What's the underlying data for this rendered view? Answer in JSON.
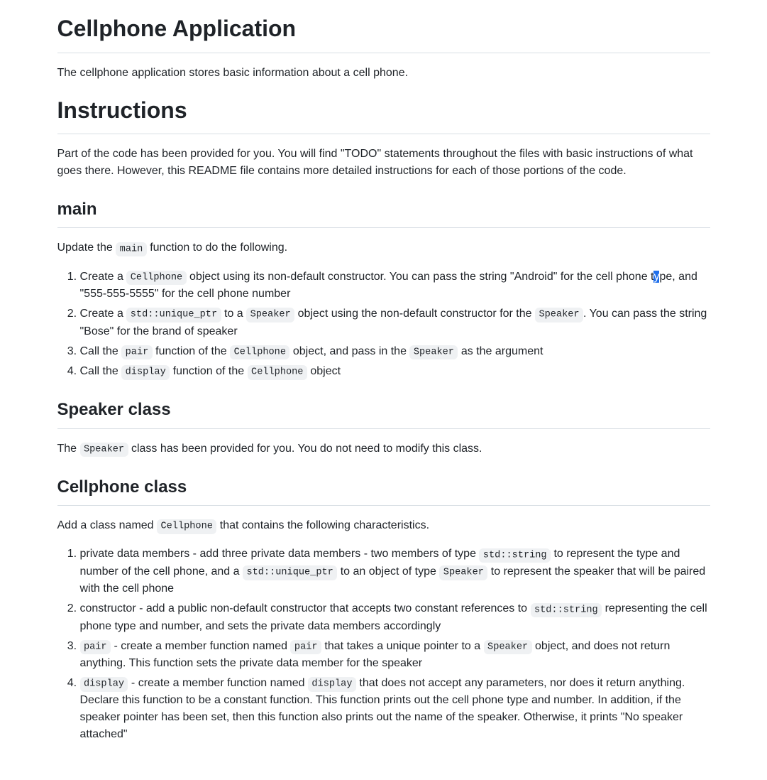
{
  "h1": "Cellphone Application",
  "intro": "The cellphone application stores basic information about a cell phone.",
  "instructions": {
    "heading": "Instructions",
    "para": "Part of the code has been provided for you. You will find \"TODO\" statements throughout the files with basic instructions of what goes there. However, this README file contains more detailed instructions for each of those portions of the code."
  },
  "main_section": {
    "heading": "main",
    "para_pre": "Update the ",
    "para_code": "main",
    "para_post": " function to do the following.",
    "item1": {
      "pre": "Create a ",
      "code1": "Cellphone",
      "mid1": " object using its non-default constructor. You can pass the string \"Android\" for the cell phone t",
      "sel": "y",
      "post": "pe, and \"555-555-5555\" for the cell phone number"
    },
    "item2": {
      "pre": "Create a ",
      "code1": "std::unique_ptr",
      "mid1": " to a ",
      "code2": "Speaker",
      "mid2": " object using the non-default constructor for the ",
      "code3": "Speaker",
      "post": ". You can pass the string \"Bose\" for the brand of speaker"
    },
    "item3": {
      "pre": "Call the ",
      "code1": "pair",
      "mid1": " function of the ",
      "code2": "Cellphone",
      "mid2": " object, and pass in the ",
      "code3": "Speaker",
      "post": " as the argument"
    },
    "item4": {
      "pre": "Call the ",
      "code1": "display",
      "mid1": " function of the ",
      "code2": "Cellphone",
      "post": " object"
    }
  },
  "speaker_section": {
    "heading": "Speaker class",
    "para_pre": "The ",
    "para_code": "Speaker",
    "para_post": " class has been provided for you. You do not need to modify this class."
  },
  "cell_section": {
    "heading": "Cellphone class",
    "para_pre": "Add a class named ",
    "para_code": "Cellphone",
    "para_post": " that contains the following characteristics.",
    "item1": {
      "pre": "private data members - add three private data members - two members of type ",
      "code1": "std::string",
      "mid1": " to represent the type and number of the cell phone, and a ",
      "code2": "std::unique_ptr",
      "mid2": " to an object of type ",
      "code3": "Speaker",
      "post": " to represent the speaker that will be paired with the cell phone"
    },
    "item2": {
      "pre": "constructor - add a public non-default constructor that accepts two constant references to ",
      "code1": "std::string",
      "post": " representing the cell phone type and number, and sets the private data members accordingly"
    },
    "item3": {
      "code0": "pair",
      "mid0": " - create a member function named ",
      "code1": "pair",
      "mid1": " that takes a unique pointer to a ",
      "code2": "Speaker",
      "post": " object, and does not return anything. This function sets the private data member for the speaker"
    },
    "item4": {
      "code0": "display",
      "mid0": " - create a member function named ",
      "code1": "display",
      "post": " that does not accept any parameters, nor does it return anything. Declare this function to be a constant function. This function prints out the cell phone type and number. In addition, if the speaker pointer has been set, then this function also prints out the name of the speaker. Otherwise, it prints \"No speaker attached\""
    }
  }
}
